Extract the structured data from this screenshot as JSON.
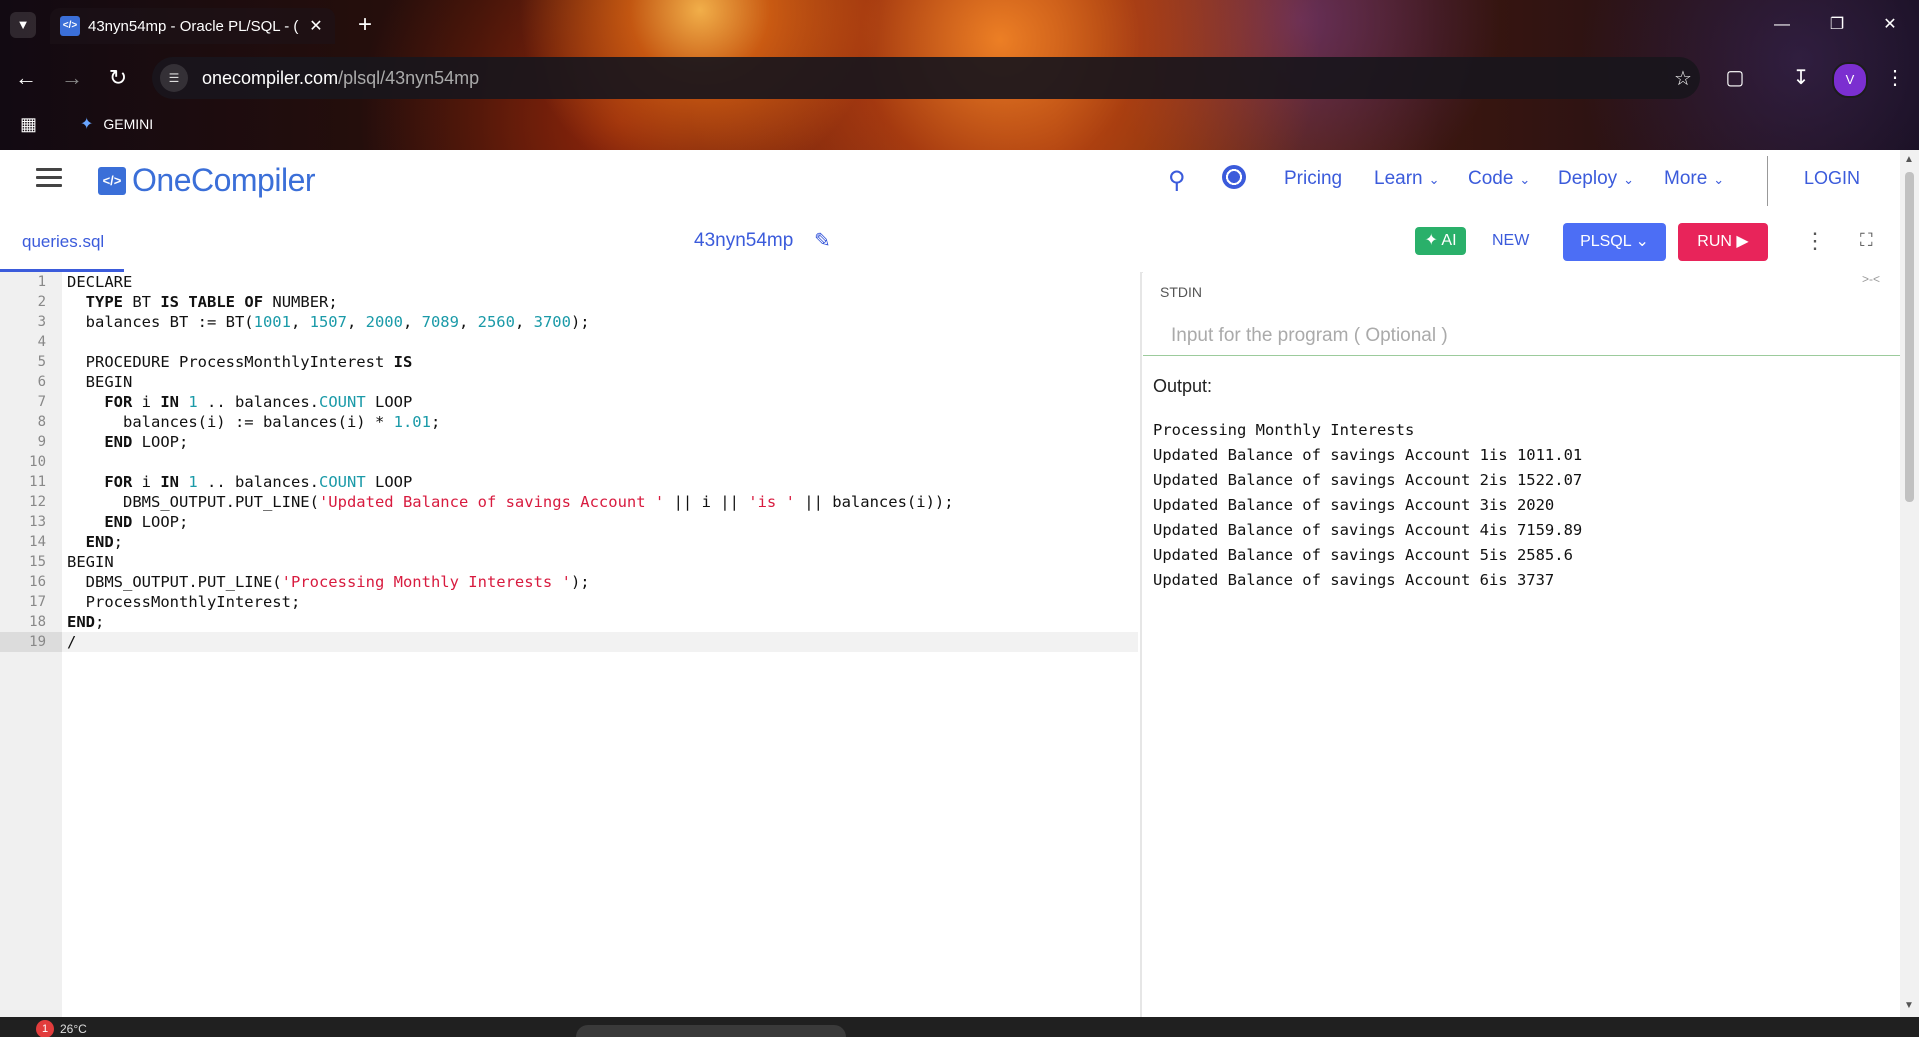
{
  "browser": {
    "tab_title": "43nyn54mp - Oracle PL/SQL - (",
    "url_host": "onecompiler.com",
    "url_path": "/plsql/43nyn54mp",
    "bookmark": "GEMINI",
    "avatar_initial": "V"
  },
  "header": {
    "logo_text": "OneCompiler",
    "nav": [
      {
        "label": "Pricing"
      },
      {
        "label": "Learn"
      },
      {
        "label": "Code"
      },
      {
        "label": "Deploy"
      },
      {
        "label": "More"
      }
    ],
    "login": "LOGIN"
  },
  "toolbar": {
    "file_tab": "queries.sql",
    "code_title": "43nyn54mp",
    "ai_label": "AI",
    "new_label": "NEW",
    "language": "PLSQL",
    "run_label": "RUN"
  },
  "editor": {
    "active_line": 19,
    "lines": [
      "DECLARE",
      "  TYPE BT IS TABLE OF NUMBER;",
      "  balances BT := BT(1001, 1507, 2000, 7089, 2560, 3700);",
      "",
      "  PROCEDURE ProcessMonthlyInterest IS",
      "  BEGIN",
      "    FOR i IN 1 .. balances.COUNT LOOP",
      "      balances(i) := balances(i) * 1.01;",
      "    END LOOP;",
      "",
      "    FOR i IN 1 .. balances.COUNT LOOP",
      "      DBMS_OUTPUT.PUT_LINE('Updated Balance of savings Account ' || i || 'is ' || balances(i));",
      "    END LOOP;",
      "  END;",
      "BEGIN",
      "  DBMS_OUTPUT.PUT_LINE('Processing Monthly Interests ');",
      "  ProcessMonthlyInterest;",
      "END;",
      "/"
    ]
  },
  "io": {
    "stdin_label": "STDIN",
    "stdin_placeholder": "Input for the program ( Optional )",
    "output_label": "Output:",
    "output_lines": [
      "Processing Monthly Interests",
      "Updated Balance of savings Account 1is 1011.01",
      "Updated Balance of savings Account 2is 1522.07",
      "Updated Balance of savings Account 3is 2020",
      "Updated Balance of savings Account 4is 7159.89",
      "Updated Balance of savings Account 5is 2585.6",
      "Updated Balance of savings Account 6is 3737"
    ]
  },
  "taskbar": {
    "weather": "26°C"
  },
  "colors": {
    "brand_blue": "#3b6fd8",
    "run_pink": "#e8245a",
    "ai_green": "#2ab06a",
    "lang_blue": "#4c6ef5"
  }
}
